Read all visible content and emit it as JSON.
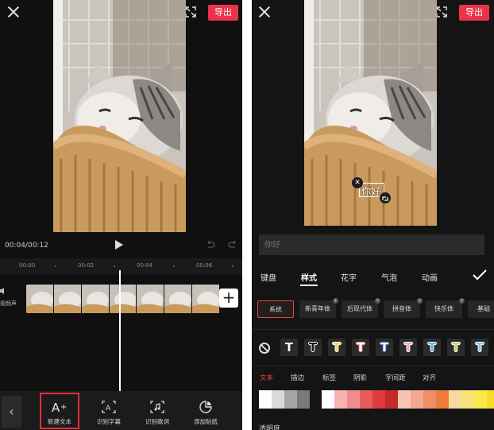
{
  "left": {
    "export_label": "导出",
    "time": "00:04/00:12",
    "ruler_ticks": [
      "00:00",
      "00:02",
      "00:04",
      "00:06"
    ],
    "track_label": "视频声",
    "add_clip": "+",
    "back": "‹",
    "tools": [
      {
        "label": "新建文本",
        "icon": "add-text-icon",
        "selected": true
      },
      {
        "label": "识别字幕",
        "icon": "recognize-subtitle-icon"
      },
      {
        "label": "识别歌词",
        "icon": "recognize-lyrics-icon"
      },
      {
        "label": "添加贴纸",
        "icon": "sticker-icon"
      }
    ]
  },
  "right": {
    "export_label": "导出",
    "overlay_text": "你好",
    "input": {
      "placeholder": "你好"
    },
    "tabs": [
      {
        "label": "键盘"
      },
      {
        "label": "样式",
        "active": true
      },
      {
        "label": "花字"
      },
      {
        "label": "气泡"
      },
      {
        "label": "动画"
      }
    ],
    "fonts": [
      {
        "label": "系统",
        "selected": true
      },
      {
        "label": "新青年体"
      },
      {
        "label": "后现代体"
      },
      {
        "label": "拼音体"
      },
      {
        "label": "快乐体"
      },
      {
        "label": "基础"
      }
    ],
    "text_styles": [
      {
        "label": "T",
        "color": "#ffffff",
        "outline": "#1a1a1a"
      },
      {
        "label": "T",
        "color": "#1a1a1a",
        "outline": "#ffffff"
      },
      {
        "label": "T",
        "color": "#f4d36a",
        "outline": "#ffffff"
      },
      {
        "label": "T",
        "color": "#ffffff",
        "outline": "#f08a8a"
      },
      {
        "label": "T",
        "color": "#ffffff",
        "outline": "#4b6cd8"
      },
      {
        "label": "T",
        "color": "#f2a6c0",
        "outline": "#ffffff"
      },
      {
        "label": "T",
        "color": "#5bb7f0",
        "outline": "#ffffff"
      },
      {
        "label": "T",
        "color": "#b9d46a",
        "outline": "#ffffff"
      },
      {
        "label": "T",
        "color": "#8fc1e8",
        "outline": "#ffffff"
      }
    ],
    "sub_tabs": [
      {
        "label": "文本",
        "active": true
      },
      {
        "label": "描边"
      },
      {
        "label": "标签"
      },
      {
        "label": "阴影"
      },
      {
        "label": "字间距"
      },
      {
        "label": "对齐"
      }
    ],
    "swatches": [
      "#ffffff",
      "#d9d9d9",
      "#a6a6a6",
      "#7a7a7a",
      "#ffffff",
      "#f7b3b3",
      "#f08c8c",
      "#ea5c5c",
      "#e13c3c",
      "#c52a2a",
      "#f6c3b5",
      "#f2a98f",
      "#ef8f6a",
      "#f07a3a",
      "#f7d9a0",
      "#f9e27a",
      "#fbe94a",
      "#f7da2a"
    ],
    "opacity_label": "透明度"
  }
}
